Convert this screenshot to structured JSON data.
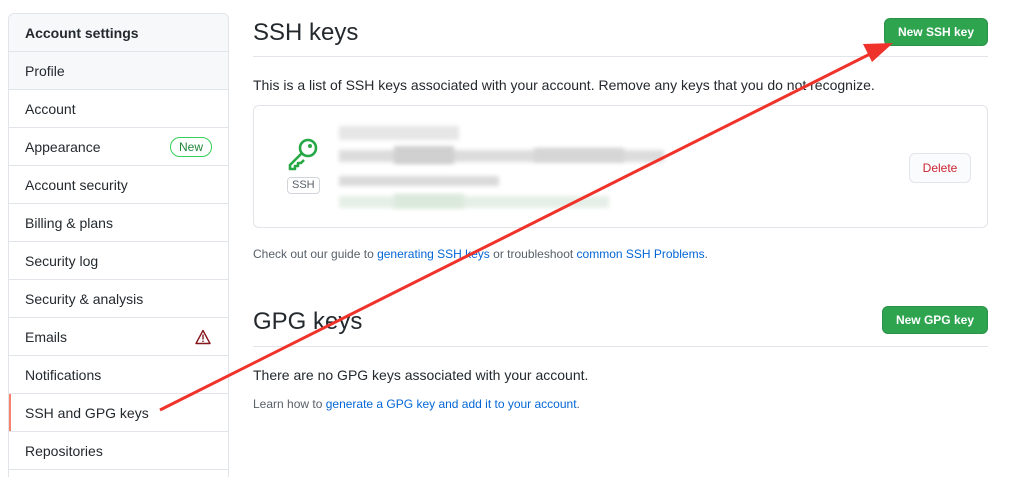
{
  "sidebar": {
    "header": "Account settings",
    "items": [
      {
        "label": "Profile"
      },
      {
        "label": "Account"
      },
      {
        "label": "Appearance",
        "badge": "New"
      },
      {
        "label": "Account security"
      },
      {
        "label": "Billing & plans"
      },
      {
        "label": "Security log"
      },
      {
        "label": "Security & analysis"
      },
      {
        "label": "Emails",
        "icon": "alert-icon"
      },
      {
        "label": "Notifications"
      },
      {
        "label": "SSH and GPG keys",
        "selected": true
      },
      {
        "label": "Repositories"
      }
    ]
  },
  "ssh": {
    "title": "SSH keys",
    "new_button": "New SSH key",
    "description": "This is a list of SSH keys associated with your account. Remove any keys that you do not recognize.",
    "key": {
      "type_label": "SSH",
      "delete_label": "Delete"
    },
    "help_prefix": "Check out our guide to ",
    "help_link1": "generating SSH keys",
    "help_middle": " or troubleshoot ",
    "help_link2": "common SSH Problems",
    "help_suffix": "."
  },
  "gpg": {
    "title": "GPG keys",
    "new_button": "New GPG key",
    "description": "There are no GPG keys associated with your account.",
    "learn_prefix": "Learn how to ",
    "learn_link": "generate a GPG key and add it to your account",
    "learn_suffix": "."
  },
  "colors": {
    "accent_green": "#2ea44f",
    "annotation_red": "#f0332a",
    "selected_marker": "#f9826c",
    "link": "#0366d6"
  }
}
